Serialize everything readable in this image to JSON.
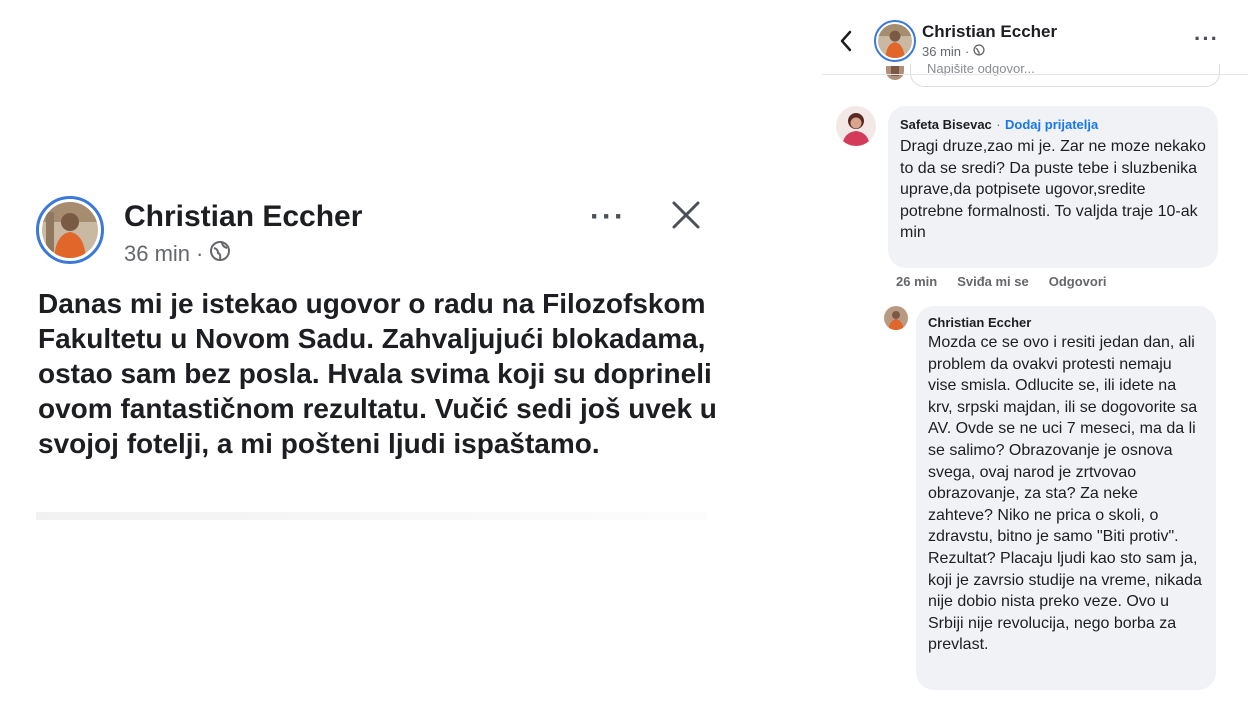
{
  "post": {
    "author": "Christian Eccher",
    "time": "36 min",
    "separator": "·",
    "more_icon": "more-horizontal-icon",
    "close_icon": "close-icon",
    "globe_icon": "globe-icon",
    "text": "Danas mi je istekao ugovor o radu na Filozofskom Fakultetu u Novom Sadu. Zahvaljujući blokadama, ostao sam bez posla. Hvala svima koji su doprineli ovom fantastičnom rezultatu. Vučić sedi još uvek u svojoj fotelji, a mi pošteni ljudi ispaštamo."
  },
  "panel": {
    "header": {
      "author": "Christian Eccher",
      "time": "36 min",
      "separator": "·"
    },
    "write_placeholder": "Napišite odgovor...",
    "comments": [
      {
        "author": "Safeta Bisevac",
        "separator": "·",
        "add_friend": "Dodaj prijatelja",
        "text": "Dragi druze,zao mi je. Zar ne moze nekako to da se sredi? Da puste tebe i sluzbenika uprave,da potpisete ugovor,sredite potrebne formalnosti. To valjda traje 10-ak min",
        "time": "26 min",
        "like": "Sviđa mi se",
        "reply": "Odgovori"
      },
      {
        "author": "Christian Eccher",
        "text": "Mozda ce se ovo i resiti jedan dan, ali problem da ovakvi protesti nemaju vise smisla. Odlucite se, ili idete na krv, srpski majdan, ili se dogovorite sa AV. Ovde se ne uci 7 meseci, ma da li se salimo? Obrazovanje je osnova svega, ovaj narod je zrtvovao obrazovanje, za sta? Za neke zahteve? Niko ne prica o skoli, o zdravstu, bitno je samo \"Biti protiv\". Rezultat? Placaju ljudi kao sto sam ja, koji je zavrsio studije na vreme, nikada nije dobio nista preko veze. Ovo u Srbiji nije revolucija, nego borba za prevlast."
      }
    ]
  }
}
